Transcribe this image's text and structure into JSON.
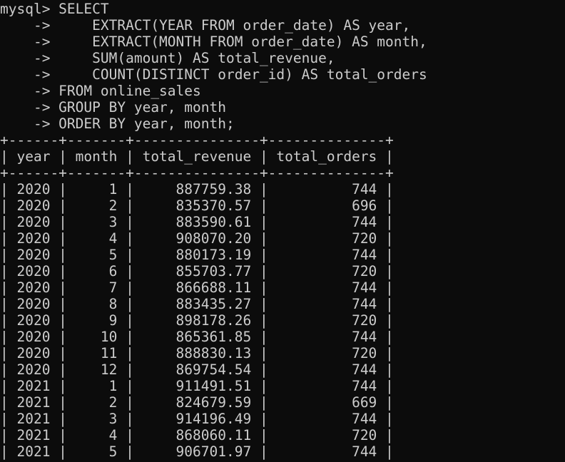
{
  "terminal": {
    "query_lines": [
      "mysql> SELECT",
      "    ->     EXTRACT(YEAR FROM order_date) AS year,",
      "    ->     EXTRACT(MONTH FROM order_date) AS month,",
      "    ->     SUM(amount) AS total_revenue,",
      "    ->     COUNT(DISTINCT order_id) AS total_orders",
      "    -> FROM online_sales",
      "    -> GROUP BY year, month",
      "    -> ORDER BY year, month;"
    ],
    "table": {
      "border_line": "+------+-------+---------------+--------------+",
      "header_line": "| year | month | total_revenue | total_orders |",
      "columns": [
        "year",
        "month",
        "total_revenue",
        "total_orders"
      ],
      "rows": [
        [
          "2020",
          "1",
          "887759.38",
          "744"
        ],
        [
          "2020",
          "2",
          "835370.57",
          "696"
        ],
        [
          "2020",
          "3",
          "883590.61",
          "744"
        ],
        [
          "2020",
          "4",
          "908070.20",
          "720"
        ],
        [
          "2020",
          "5",
          "880173.19",
          "744"
        ],
        [
          "2020",
          "6",
          "855703.77",
          "720"
        ],
        [
          "2020",
          "7",
          "866688.11",
          "744"
        ],
        [
          "2020",
          "8",
          "883435.27",
          "744"
        ],
        [
          "2020",
          "9",
          "898178.26",
          "720"
        ],
        [
          "2020",
          "10",
          "865361.85",
          "744"
        ],
        [
          "2020",
          "11",
          "888830.13",
          "720"
        ],
        [
          "2020",
          "12",
          "869754.54",
          "744"
        ],
        [
          "2021",
          "1",
          "911491.51",
          "744"
        ],
        [
          "2021",
          "2",
          "824679.59",
          "669"
        ],
        [
          "2021",
          "3",
          "914196.49",
          "744"
        ],
        [
          "2021",
          "4",
          "868060.11",
          "720"
        ],
        [
          "2021",
          "5",
          "906701.97",
          "744"
        ]
      ]
    }
  }
}
